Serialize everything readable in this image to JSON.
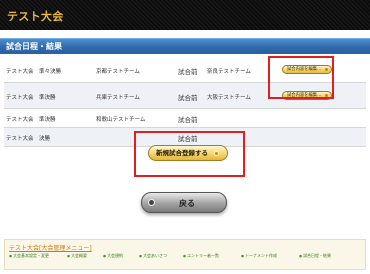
{
  "header": {
    "app_title": "テスト大会"
  },
  "section": {
    "title": "試合日程・結果"
  },
  "schedule": {
    "rows": [
      {
        "tournament": "テスト大会",
        "round": "準々決勝",
        "home": "京都テストチーム",
        "status": "試合前",
        "away": "奈良テストチーム",
        "edit_label": "試合内容を編集..."
      },
      {
        "tournament": "テスト大会",
        "round": "準決勝",
        "home": "兵庫テストチーム",
        "status": "試合前",
        "away": "大阪テストチーム",
        "edit_label": "試合内容を編集..."
      },
      {
        "tournament": "テスト大会",
        "round": "準決勝",
        "home": "和歌山テストチーム",
        "status": "試合前",
        "away": ""
      },
      {
        "tournament": "テスト大会",
        "round": "決勝",
        "home": "",
        "status": "試合前",
        "away": ""
      }
    ]
  },
  "actions": {
    "new_match_label": "新規試合登録する",
    "back_label": "戻る"
  },
  "footer": {
    "menu_title": "テスト大会[大会管理メニュー]",
    "links": [
      "大会基本設定・変更",
      "大会概要",
      "大会規約",
      "大会あいさつ",
      "エントリー者一覧",
      "トーナメント作成",
      "試合日程・結果"
    ]
  },
  "colors": {
    "title_gold": "#e8b83c",
    "section_blue": "#2f6aac",
    "highlight_red": "#e02020",
    "button_gold": "#f2d777",
    "link_green": "#2f7a1a"
  }
}
